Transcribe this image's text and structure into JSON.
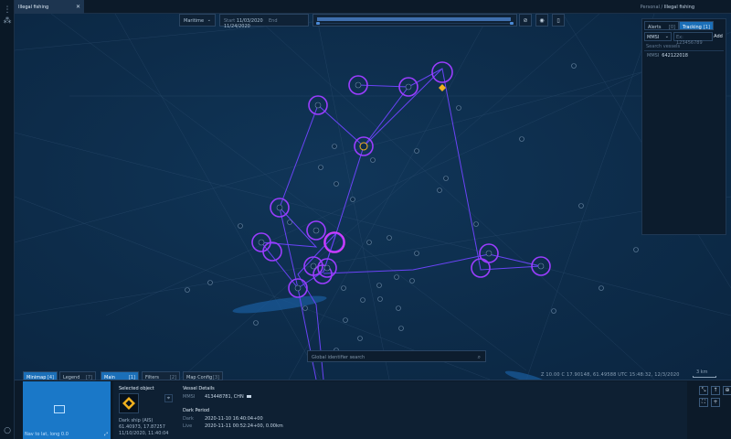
{
  "app": {
    "tab_title": "Illegal fishing",
    "breadcrumb_prefix": "Personal /",
    "breadcrumb_current": "Illegal fishing"
  },
  "toolbar": {
    "layer_select": "Maritime",
    "start_label": "Start",
    "start_date": "11/03/2020",
    "end_label": "End",
    "end_date": "11/24/2020",
    "timeline_fill_fraction": 0.98
  },
  "right_panel": {
    "tabs": [
      {
        "label": "Alerts",
        "count": "[0]"
      },
      {
        "label": "Tracking",
        "count": "[1]"
      }
    ],
    "active_tab": "Tracking",
    "id_type": "MMSI",
    "id_placeholder": "Ex: 123456789",
    "add_label": "Add",
    "search_placeholder": "Search vessels",
    "items": [
      {
        "type": "MMSI",
        "value": "642122018"
      }
    ]
  },
  "global_search_placeholder": "Global identifier search",
  "status": {
    "coords": "Z 10.00   C 17.90148, 61.49588   UTC 15:48:32, 12/3/2020",
    "scale": "3 km"
  },
  "bottom_tabs": {
    "left": [
      {
        "label": "Minimap",
        "count": "[4]"
      },
      {
        "label": "Legend",
        "count": "[7]"
      }
    ],
    "main": [
      {
        "label": "Main",
        "count": "[1]"
      },
      {
        "label": "Filters",
        "count": "[2]"
      },
      {
        "label": "Map Config",
        "count": "[3]"
      }
    ]
  },
  "minimap": {
    "caption": "Nav to lat, long 0.0"
  },
  "selected_object": {
    "title": "Selected object",
    "type": "Dark ship (AIS)",
    "position": "61.40973, 17.87257",
    "timestamp": "11/10/2020, 11:40:04"
  },
  "vessel_details": {
    "title": "Vessel Details",
    "mmsi_label": "MMSI",
    "mmsi_value": "413448781, CHN",
    "dark_title": "Dark Period",
    "dark_label": "Dark",
    "dark_value": "2020-11-10 16:40:04+00",
    "live_label": "Live",
    "live_value": "2020-11-11 00:52:24+00, 0.00km"
  },
  "colors": {
    "accent": "#1b6fb8",
    "track": "#7b4dff",
    "highlight_ring": "#b14dff",
    "map_bg": "#0d2c4a"
  },
  "icons": {
    "leftbar": [
      "grid-icon",
      "circle-icon"
    ],
    "toolbar": [
      "layer-toggle-icon",
      "eye-icon",
      "bookmark-icon"
    ]
  }
}
